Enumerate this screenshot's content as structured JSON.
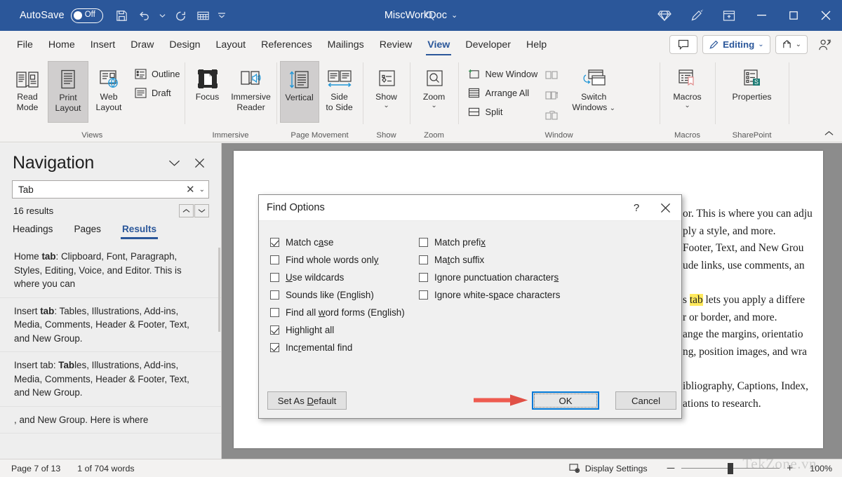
{
  "titlebar": {
    "autosave_label": "AutoSave",
    "autosave_state": "Off",
    "doc_title": "MiscWorkDoc",
    "icons": [
      "save-icon",
      "undo-icon",
      "undo-dropdown-icon",
      "redo-icon",
      "table-icon",
      "quick-access-more-icon"
    ],
    "search_icon": "search-icon",
    "diamond_icon": "diamond-icon",
    "pen_icon": "pen-icon",
    "ribbon_display_icon": "ribbon-display-options-icon",
    "minimize_label": "─",
    "maximize_label": "□",
    "close_label": "✕",
    "accent": "#2b579a"
  },
  "ribbon_tabs": {
    "items": [
      {
        "label": "File",
        "active": false
      },
      {
        "label": "Home",
        "active": false
      },
      {
        "label": "Insert",
        "active": false
      },
      {
        "label": "Draw",
        "active": false
      },
      {
        "label": "Design",
        "active": false
      },
      {
        "label": "Layout",
        "active": false
      },
      {
        "label": "References",
        "active": false
      },
      {
        "label": "Mailings",
        "active": false
      },
      {
        "label": "Review",
        "active": false
      },
      {
        "label": "View",
        "active": true
      },
      {
        "label": "Developer",
        "active": false
      },
      {
        "label": "Help",
        "active": false
      }
    ],
    "comments_icon": "comment-icon",
    "editing_label": "Editing",
    "editing_icon": "pencil-icon",
    "share_icon": "share-icon",
    "person_icon": "person-add-icon"
  },
  "ribbon": {
    "groups": [
      {
        "title": "Views",
        "buttons": [
          {
            "label": "Read\nMode",
            "label_line1": "Read",
            "label_line2": "Mode",
            "icon": "read-mode-icon",
            "selected": false
          },
          {
            "label_line1": "Print",
            "label_line2": "Layout",
            "icon": "print-layout-icon",
            "selected": true
          },
          {
            "label_line1": "Web",
            "label_line2": "Layout",
            "icon": "web-layout-icon",
            "selected": false
          }
        ],
        "small_buttons": [
          {
            "label": "Outline",
            "icon": "outline-icon"
          },
          {
            "label": "Draft",
            "icon": "draft-icon"
          }
        ]
      },
      {
        "title": "Immersive",
        "buttons": [
          {
            "label_line1": "Focus",
            "label_line2": "",
            "icon": "focus-icon",
            "selected": false
          },
          {
            "label_line1": "Immersive",
            "label_line2": "Reader",
            "icon": "immersive-reader-icon",
            "selected": false
          }
        ],
        "small_buttons": []
      },
      {
        "title": "Page Movement",
        "buttons": [
          {
            "label_line1": "Vertical",
            "label_line2": "",
            "icon": "vertical-scroll-icon",
            "selected": true
          },
          {
            "label_line1": "Side",
            "label_line2": "to Side",
            "icon": "side-to-side-icon",
            "selected": false
          }
        ],
        "small_buttons": []
      },
      {
        "title": "Show",
        "buttons": [
          {
            "label_line1": "Show",
            "label_line2": "",
            "icon": "show-icon",
            "dropdown": true,
            "selected": false
          }
        ],
        "small_buttons": []
      },
      {
        "title": "Zoom",
        "buttons": [
          {
            "label_line1": "Zoom",
            "label_line2": "",
            "icon": "zoom-magnifier-icon",
            "dropdown": true,
            "selected": false
          }
        ],
        "small_buttons": []
      },
      {
        "title": "Window",
        "buttons": [
          {
            "label_line1": "Switch",
            "label_line2": "Windows",
            "icon": "switch-windows-icon",
            "dropdown": true,
            "selected": false
          }
        ],
        "small_buttons": [
          {
            "label": "New Window",
            "icon": "new-window-icon"
          },
          {
            "label": "Arrange All",
            "icon": "arrange-all-icon"
          },
          {
            "label": "Split",
            "icon": "split-icon"
          }
        ],
        "disabled_icons": [
          "view-side-by-side-icon",
          "synchronous-scrolling-icon",
          "reset-window-position-icon"
        ]
      },
      {
        "title": "Macros",
        "buttons": [
          {
            "label_line1": "Macros",
            "label_line2": "",
            "icon": "macros-icon",
            "dropdown": true,
            "selected": false
          }
        ],
        "small_buttons": []
      },
      {
        "title": "SharePoint",
        "buttons": [
          {
            "label_line1": "Properties",
            "label_line2": "",
            "icon": "sharepoint-properties-icon",
            "selected": false
          }
        ],
        "small_buttons": []
      }
    ],
    "collapse_icon": "chevron-up-icon"
  },
  "navigation": {
    "title": "Navigation",
    "dropdown_icon": "chevron-down-icon",
    "close_icon": "close-icon",
    "search_value": "Tab",
    "search_clear_icon": "clear-icon",
    "search_dropdown_icon": "chevron-down-icon",
    "results_count": "16 results",
    "prev_icon": "chevron-up-icon",
    "next_icon": "chevron-down-icon",
    "tabs": [
      {
        "label": "Headings",
        "active": false
      },
      {
        "label": "Pages",
        "active": false
      },
      {
        "label": "Results",
        "active": true
      }
    ],
    "results": [
      {
        "prefix": "Home ",
        "bold": "tab",
        "suffix": ": Clipboard, Font, Paragraph, Styles, Editing, Voice, and Editor. This is where you can"
      },
      {
        "prefix": "Insert ",
        "bold": "tab",
        "suffix": ": Tables, Illustrations, Add-ins, Media, Comments, Header & Footer, Text, and New Group."
      },
      {
        "prefix": "Insert tab: ",
        "bold": "Tab",
        "suffix": "les, Illustrations, Add-ins, Media, Comments, Header & Footer, Text, and New Group."
      },
      {
        "prefix": ", and New Group. Here is where",
        "bold": "",
        "suffix": ""
      }
    ]
  },
  "document": {
    "lines": [
      {
        "text": "or. This is where you can adju",
        "type": "text"
      },
      {
        "text": "ply a style, and more.",
        "type": "text"
      },
      {
        "text": "Footer, Text, and New Grou",
        "type": "text"
      },
      {
        "text": "ude links, use comments, an",
        "type": "text"
      },
      {
        "text": "",
        "type": "blank"
      },
      {
        "pre": "s ",
        "highlight": "tab",
        "post": " lets you apply a differe",
        "type": "highlight"
      },
      {
        "text": "r or border, and more.",
        "type": "text"
      },
      {
        "text": "ange the margins, orientatio",
        "type": "text"
      },
      {
        "text": "ng, position images, and wra",
        "type": "text"
      },
      {
        "text": "",
        "type": "blank"
      },
      {
        "text": "ibliography, Captions, Index,",
        "type": "text"
      },
      {
        "text": "ations to research.",
        "type": "text"
      }
    ],
    "highlight_color": "#ffe95c"
  },
  "dialog": {
    "title": "Find Options",
    "help_label": "?",
    "close_label": "✕",
    "checkboxes_left": [
      {
        "pre": "Match c",
        "accel": "a",
        "post": "se",
        "label": "Match case",
        "checked": true
      },
      {
        "pre": "Find whole words onl",
        "accel": "y",
        "post": "",
        "label": "Find whole words only",
        "checked": false
      },
      {
        "pre": "",
        "accel": "U",
        "post": "se wildcards",
        "label": "Use wildcards",
        "checked": false
      },
      {
        "pre": "Sounds like (English)",
        "accel": "",
        "post": "",
        "label": "Sounds like (English)",
        "checked": false
      },
      {
        "pre": "Find all ",
        "accel": "w",
        "post": "ord forms (English)",
        "label": "Find all word forms (English)",
        "checked": false
      },
      {
        "pre": "Highli",
        "accel": "g",
        "post": "ht all",
        "label": "Highlight all",
        "checked": true
      },
      {
        "pre": "Inc",
        "accel": "r",
        "post": "emental find",
        "label": "Incremental find",
        "checked": true
      }
    ],
    "checkboxes_right": [
      {
        "pre": "Match prefi",
        "accel": "x",
        "post": "",
        "label": "Match prefix",
        "checked": false
      },
      {
        "pre": "Ma",
        "accel": "t",
        "post": "ch suffix",
        "label": "Match suffix",
        "checked": false
      },
      {
        "pre": "Ignore punctuation character",
        "accel": "s",
        "post": "",
        "label": "Ignore punctuation characters",
        "checked": false
      },
      {
        "pre": "Ignore white-s",
        "accel": "p",
        "post": "ace characters",
        "label": "Ignore white-space characters",
        "checked": false
      }
    ],
    "set_default_pre": "Set As ",
    "set_default_accel": "D",
    "set_default_post": "efault",
    "ok_label": "OK",
    "cancel_label": "Cancel",
    "arrow_color": "#ee5b50",
    "focus_color": "#0078d7"
  },
  "statusbar": {
    "page": "Page 7 of 13",
    "words": "1 of 704 words",
    "display_settings": "Display Settings",
    "display_settings_icon": "display-settings-icon",
    "zoom_out_label": "─",
    "zoom_in_label": "+",
    "zoom_percent": "100%"
  },
  "watermark": "TekZone.vn"
}
